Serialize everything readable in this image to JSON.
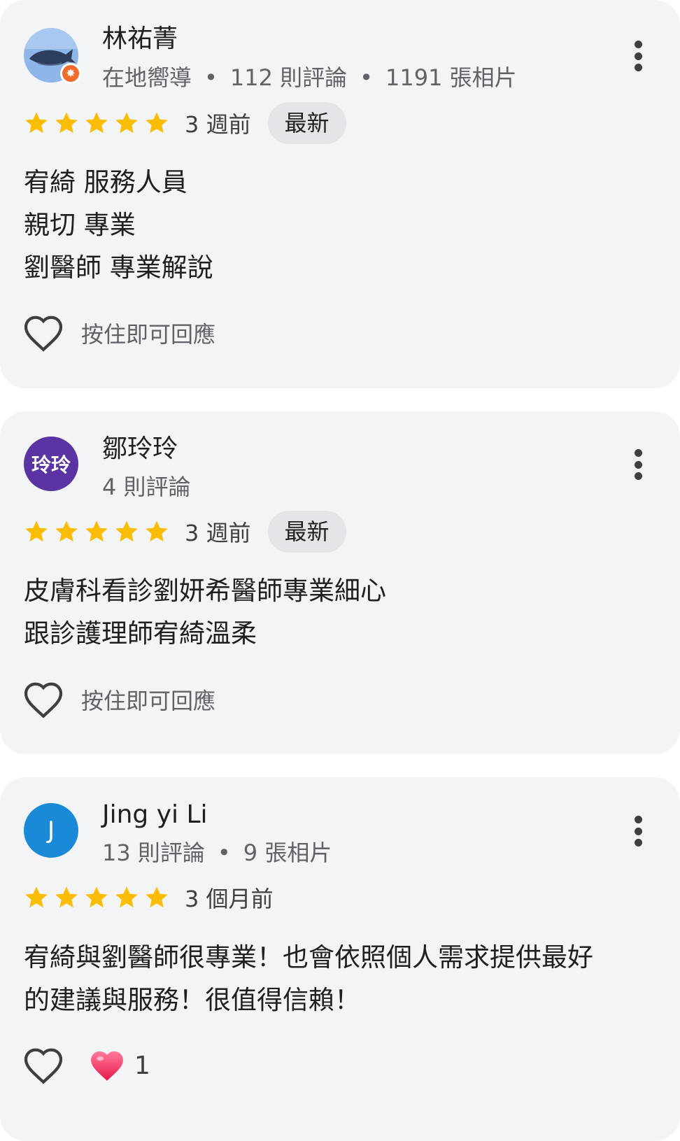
{
  "colors": {
    "card_background": "#f3f4f6",
    "star": "#fbbc04",
    "chip_background": "#e3e5e8",
    "secondary_text": "#5f6368",
    "avatar_1": "#5b34a3",
    "avatar_2": "#1a8ad8",
    "badge": "#f26b2a"
  },
  "reviews": [
    {
      "author": "林祐菁",
      "avatar": {
        "type": "image",
        "icon": "whale-icon",
        "badge_icon": "local-guide-badge-icon"
      },
      "meta": [
        "在地嚮導",
        "112 則評論",
        "1191 張相片"
      ],
      "rating": 5,
      "time": "3 週前",
      "chip": "最新",
      "body": [
        "宥綺 服務人員",
        "親切 專業",
        "劉醫師 專業解說"
      ],
      "react_hint": "按住即可回應"
    },
    {
      "author": "鄒玲玲",
      "avatar": {
        "type": "text",
        "text": "玲玲"
      },
      "meta": [
        "4 則評論"
      ],
      "rating": 5,
      "time": "3 週前",
      "chip": "最新",
      "body": [
        "皮膚科看診劉妍希醫師專業細心",
        "跟診護理師宥綺溫柔"
      ],
      "react_hint": "按住即可回應"
    },
    {
      "author": "Jing yi Li",
      "avatar": {
        "type": "text",
        "text": "J"
      },
      "meta": [
        "13 則評論",
        "9 張相片"
      ],
      "rating": 5,
      "time": "3 個月前",
      "body": [
        "宥綺與劉醫師很專業！也會依照個人需求提供最好",
        "的建議與服務！很值得信賴！"
      ],
      "reactions": {
        "icon": "heart-icon",
        "count": "1"
      }
    }
  ]
}
